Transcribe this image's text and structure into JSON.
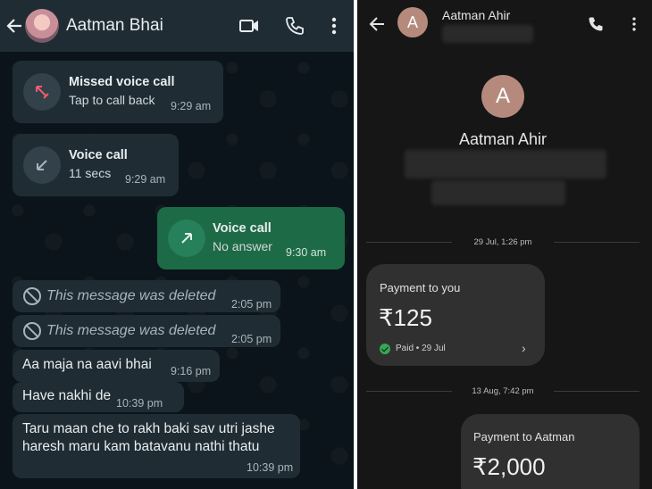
{
  "whatsapp": {
    "contact_name": "Aatman Bhai",
    "messages": {
      "missed_call": {
        "title": "Missed voice call",
        "subtitle": "Tap to call back",
        "time": "9:29 am"
      },
      "voice_call_in": {
        "title": "Voice call",
        "subtitle": "11 secs",
        "time": "9:29 am"
      },
      "voice_call_out": {
        "title": "Voice call",
        "subtitle": "No answer",
        "time": "9:30 am"
      },
      "deleted_1": {
        "text": "This message was deleted",
        "time": "2:05 pm"
      },
      "deleted_2": {
        "text": "This message was deleted",
        "time": "2:05 pm"
      },
      "text_1": {
        "text": "Aa maja na aavi bhai",
        "time": "9:16 pm"
      },
      "text_2": {
        "text": "Have nakhi de",
        "time": "10:39 pm"
      },
      "text_3": {
        "line1": "Taru maan che to rakh baki sav utri jashe",
        "line2": "haresh maru kam batavanu nathi thatu",
        "time": "10:39 pm"
      }
    },
    "icons": [
      "back-arrow-icon",
      "video-call-icon",
      "phone-icon",
      "more-vert-icon",
      "missed-call-icon",
      "incoming-call-icon",
      "outgoing-call-icon",
      "deleted-icon"
    ],
    "colors": {
      "header": "#1f2c34",
      "background": "#0b141a",
      "incoming_bubble": "#1f2c34",
      "outgoing_bubble": "#1d6b46"
    }
  },
  "gpay": {
    "avatar_letter": "A",
    "header_name": "Aatman Ahir",
    "profile_name": "Aatman Ahir",
    "transactions": [
      {
        "date": "29 Jul, 1:26 pm",
        "title": "Payment to you",
        "amount": "₹125",
        "status": "Paid • 29 Jul"
      },
      {
        "date": "13 Aug, 7:42 pm",
        "title": "Payment to Aatman",
        "amount": "₹2,000"
      }
    ],
    "icons": [
      "back-arrow-icon",
      "phone-icon",
      "more-vert-icon",
      "check-circle-icon",
      "chevron-right-icon"
    ],
    "colors": {
      "background": "#161616",
      "card": "#303030",
      "avatar": "#b58a7d",
      "paid_check": "#34a853"
    }
  }
}
